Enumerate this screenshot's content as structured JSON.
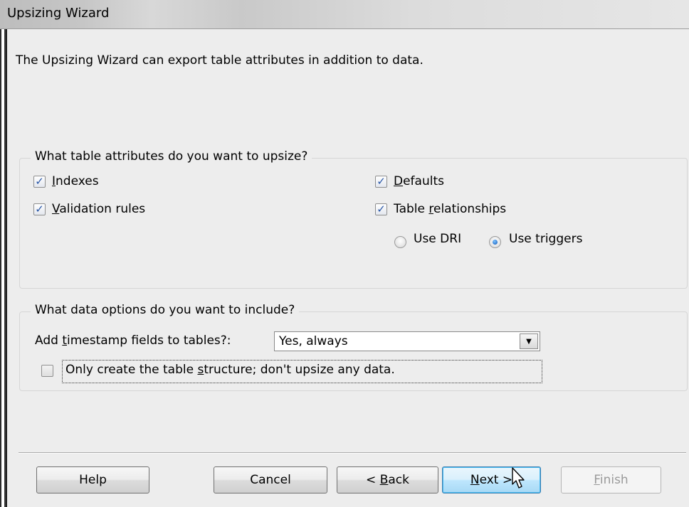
{
  "window": {
    "title": "Upsizing  Wizard"
  },
  "intro_text": "The Upsizing Wizard can export table attributes in addition to data.",
  "attributes_group": {
    "legend": "What table attributes do you want to upsize?",
    "indexes": {
      "prefix": "",
      "accel": "I",
      "rest": "ndexes",
      "checked": true
    },
    "validation_rules": {
      "prefix": "",
      "accel": "V",
      "rest": "alidation rules",
      "checked": true
    },
    "defaults": {
      "prefix": "",
      "accel": "D",
      "rest": "efaults",
      "checked": true
    },
    "table_relationships": {
      "prefix": "Table ",
      "accel": "r",
      "rest": "elationships",
      "checked": true
    },
    "use_dri": {
      "label": "Use DRI",
      "selected": false
    },
    "use_triggers": {
      "label": "Use triggers",
      "selected": true
    }
  },
  "data_group": {
    "legend": "What data options do you want to include?",
    "timestamp_label": {
      "prefix": "Add ",
      "accel": "t",
      "rest": "imestamp fields to tables?:"
    },
    "timestamp_value": "Yes, always",
    "structure_only": {
      "prefix": "Only create the table ",
      "accel": "s",
      "rest": "tructure; don't upsize any data.",
      "checked": false
    }
  },
  "buttons": {
    "help": "Help",
    "cancel": "Cancel",
    "back": {
      "prefix": "< ",
      "accel": "B",
      "rest": "ack"
    },
    "next": {
      "prefix": "",
      "accel": "N",
      "rest": "ext >"
    },
    "finish": {
      "prefix": "",
      "accel": "F",
      "rest": "inish",
      "enabled": false
    }
  },
  "icons": {
    "check": "checkmark-icon",
    "dropdown": "chevron-down-icon",
    "cursor": "mouse-pointer-icon"
  }
}
